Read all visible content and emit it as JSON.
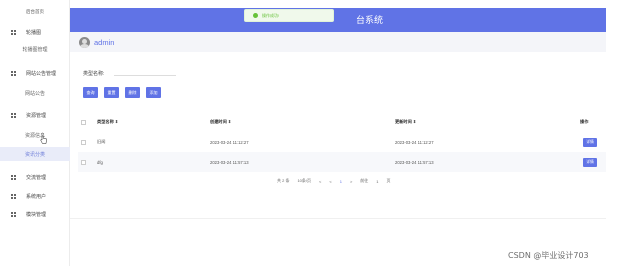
{
  "sidebar": {
    "title": "后台首页",
    "items": [
      {
        "label": "轮播图",
        "kind": "parent"
      },
      {
        "label": "轮播图管理",
        "kind": "child"
      },
      {
        "label": "网站公告管理",
        "kind": "parent"
      },
      {
        "label": "网站公告",
        "kind": "child"
      },
      {
        "label": "资源管理",
        "kind": "parent"
      },
      {
        "label": "资源信息",
        "kind": "child"
      },
      {
        "label": "资讯分类",
        "kind": "child",
        "active": true
      },
      {
        "label": "交流管理",
        "kind": "parent"
      },
      {
        "label": "系统用户",
        "kind": "parent"
      },
      {
        "label": "模块管理",
        "kind": "parent"
      }
    ]
  },
  "header": {
    "title": "台系统"
  },
  "toast": {
    "text": "操作成功!"
  },
  "user": {
    "name": "admin"
  },
  "search": {
    "label": "类型名称:",
    "value": "",
    "placeholder": ""
  },
  "buttons": {
    "query": "查询",
    "reset": "重置",
    "delete": "删除",
    "add": "添加"
  },
  "table": {
    "headers": [
      "类型名称 ⇕",
      "创建时间 ⇕",
      "更新时间 ⇕",
      "操作"
    ],
    "rows": [
      {
        "name": "旧闻",
        "created": "2023-03-24 11:12:27",
        "updated": "2023-03-24 11:12:27",
        "action": "详情"
      },
      {
        "name": "dfg",
        "created": "2023-03-24 11:57:13",
        "updated": "2023-03-24 11:57:13",
        "action": "详情"
      }
    ]
  },
  "pager": {
    "total": "共 2 条",
    "per_page": "10条/页",
    "prev": "<",
    "prev2": "<",
    "page": "1",
    "next": ">",
    "goto": "前往",
    "goto_value": "1",
    "page_unit": "页"
  },
  "watermark": "CSDN @毕业设计703",
  "colors": {
    "accent": "#6073e6",
    "sidebar_active_bg": "#e9ecf9",
    "toast_bg": "#f0f9eb",
    "toast_text": "#67c23a"
  }
}
